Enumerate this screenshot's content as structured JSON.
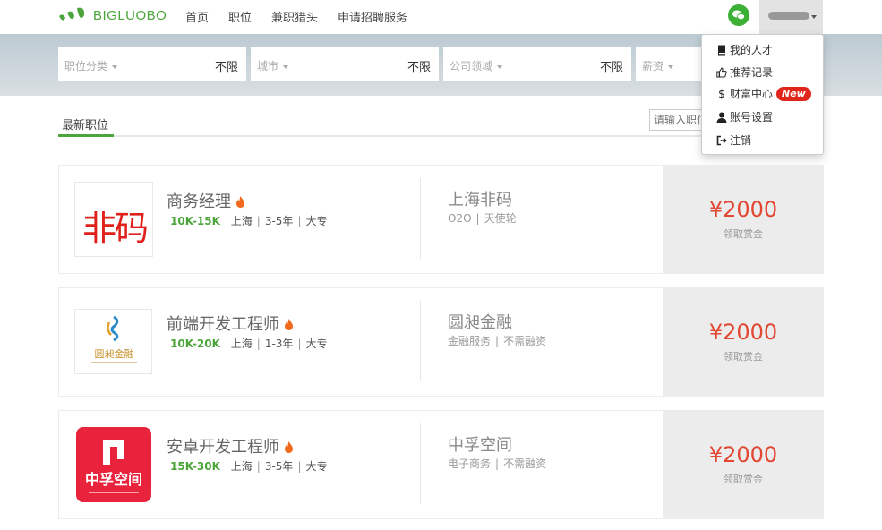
{
  "brand": {
    "name": "BIGLUOBO",
    "color": "#4ca53a"
  },
  "nav": {
    "items": [
      "首页",
      "职位",
      "兼职猎头",
      "申请招聘服务"
    ]
  },
  "filters": [
    {
      "label": "职位分类",
      "value": "不限"
    },
    {
      "label": "城市",
      "value": "不限"
    },
    {
      "label": "公司领域",
      "value": "不限"
    },
    {
      "label": "薪资",
      "value": ""
    }
  ],
  "tabs": {
    "active": "最新职位"
  },
  "search": {
    "placeholder": "请输入职位"
  },
  "jobs": [
    {
      "title": "商务经理",
      "salary": "10K-15K",
      "city": "上海",
      "experience": "3-5年",
      "education": "大专",
      "company": "上海非码",
      "company_tags": [
        "O2O",
        "天使轮"
      ],
      "logo_text": "非码",
      "reward": "¥2000",
      "reward_label": "领取赏金"
    },
    {
      "title": "前端开发工程师",
      "salary": "10K-20K",
      "city": "上海",
      "experience": "1-3年",
      "education": "大专",
      "company": "圆昶金融",
      "company_tags": [
        "金融服务",
        "不需融资"
      ],
      "logo_text": "圆昶金融",
      "reward": "¥2000",
      "reward_label": "领取赏金"
    },
    {
      "title": "安卓开发工程师",
      "salary": "15K-30K",
      "city": "上海",
      "experience": "3-5年",
      "education": "大专",
      "company": "中孚空间",
      "company_tags": [
        "电子商务",
        "不需融资"
      ],
      "logo_text": "中孚空间",
      "reward": "¥2000",
      "reward_label": "领取赏金"
    }
  ],
  "user_menu": {
    "items": [
      {
        "label": "我的人才",
        "icon": "book-icon"
      },
      {
        "label": "推荐记录",
        "icon": "thumbs-up-icon"
      },
      {
        "label": "财富中心",
        "icon": "dollar-icon",
        "badge": "New"
      },
      {
        "label": "账号设置",
        "icon": "user-icon"
      },
      {
        "label": "注销",
        "icon": "logout-icon"
      }
    ]
  },
  "colors": {
    "accent": "#4ca53a",
    "reward": "#e14733",
    "badge": "#e0251b"
  }
}
